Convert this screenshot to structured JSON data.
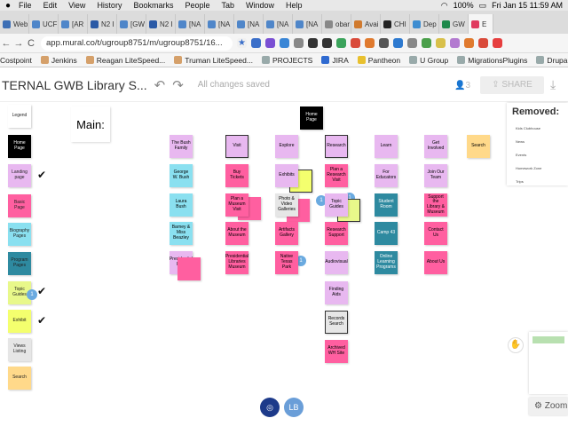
{
  "menubar": {
    "apple": "",
    "items": [
      "File",
      "Edit",
      "View",
      "History",
      "Bookmarks",
      "People",
      "Tab",
      "Window",
      "Help"
    ],
    "battery": "100%",
    "clock": "Fri Jan 15  11:59 AM"
  },
  "tabs": [
    {
      "label": "Web",
      "color": "#3d6fb5"
    },
    {
      "label": "UCF",
      "color": "#4f86c9"
    },
    {
      "label": "[AR",
      "color": "#4f86c9"
    },
    {
      "label": "N2 I",
      "color": "#2b5aa6"
    },
    {
      "label": "[GW",
      "color": "#4f86c9"
    },
    {
      "label": "N2 I",
      "color": "#2b5aa6"
    },
    {
      "label": "[NA",
      "color": "#4f86c9"
    },
    {
      "label": "[NA",
      "color": "#4f86c9"
    },
    {
      "label": "[NA",
      "color": "#4f86c9"
    },
    {
      "label": "[NA",
      "color": "#4f86c9"
    },
    {
      "label": "[NA",
      "color": "#4f86c9"
    },
    {
      "label": "obar",
      "color": "#888888"
    },
    {
      "label": "Avai",
      "color": "#d07a2e"
    },
    {
      "label": "CHI",
      "color": "#222222"
    },
    {
      "label": "Dep",
      "color": "#3e8dd1"
    },
    {
      "label": "GW",
      "color": "#1f8a4c"
    },
    {
      "label": "E",
      "color": "#e03a5f"
    }
  ],
  "address": {
    "url": "app.mural.co/t/ugroup8751/m/ugroup8751/16...",
    "back": "←",
    "forward": "→",
    "reload": "C"
  },
  "bookmarks": [
    "Costpoint",
    "Jenkins",
    "Reagan LiteSpeed...",
    "Truman LiteSpeed...",
    "PROJECTS",
    "JIRA",
    "Pantheon",
    "U Group",
    "MigrationsPlugins",
    "Drupal"
  ],
  "appbar": {
    "title": "TERNAL GWB Library S...",
    "status": "All changes saved",
    "members": "3",
    "share": "SHARE"
  },
  "canvas": {
    "main_title": "Main:",
    "removed_title": "Removed:",
    "removed_items": [
      "Kids Clubhouse",
      "News",
      "Events",
      "Homework Zone",
      "Trips"
    ],
    "zoom_label": "Zoom",
    "avatar_initials": "LB",
    "legend": [
      {
        "label": "Legend",
        "color": "#ffffff"
      },
      {
        "label": "Home Page",
        "color": "#000000",
        "text": "#ffffff"
      },
      {
        "label": "Landing page",
        "color": "#e8b8f0"
      },
      {
        "label": "Basic Page",
        "color": "#ff5fa0"
      },
      {
        "label": "Biography Pages",
        "color": "#8ae0f0"
      },
      {
        "label": "Program Pages",
        "color": "#2e8aa0"
      },
      {
        "label": "Topic Guides",
        "color": "#e8f88a"
      },
      {
        "label": "Exhibit",
        "color": "#f4ff6e"
      },
      {
        "label": "Views Listing",
        "color": "#e6e6e6"
      },
      {
        "label": "Search",
        "color": "#ffd98a"
      }
    ],
    "home": "Home Page",
    "col_bush": [
      "The Bush Family",
      "George W. Bush",
      "Laura Bush",
      "Barney & Miss Beazley",
      "Presidential Pets"
    ],
    "col_visit": [
      "Visit",
      "Buy Tickets",
      "Plan a Museum Visit",
      "About the Museum",
      "Presidential Libraries Museum"
    ],
    "col_explore": [
      "Explore",
      "Exhibits",
      "Photo & Video Galleries",
      "Artifacts Gallery",
      "Native Texas Park"
    ],
    "col_research": [
      "Research",
      "Plan a Research Visit",
      "Topic Guides",
      "Research Support",
      "Audiovisual",
      "Finding Aids",
      "Records Search",
      "Archived WH Site"
    ],
    "col_learn": [
      "Learn",
      "For Educators",
      "Student Room",
      "Camp 43",
      "Online Learning Programs"
    ],
    "col_get": [
      "Get Involved",
      "Join Our Team",
      "Support the Library & Museum",
      "Contact Us",
      "About Us"
    ],
    "search_note": "Search",
    "extra_notes": [
      "Exhibit",
      "ts",
      "rk",
      "ides"
    ]
  }
}
